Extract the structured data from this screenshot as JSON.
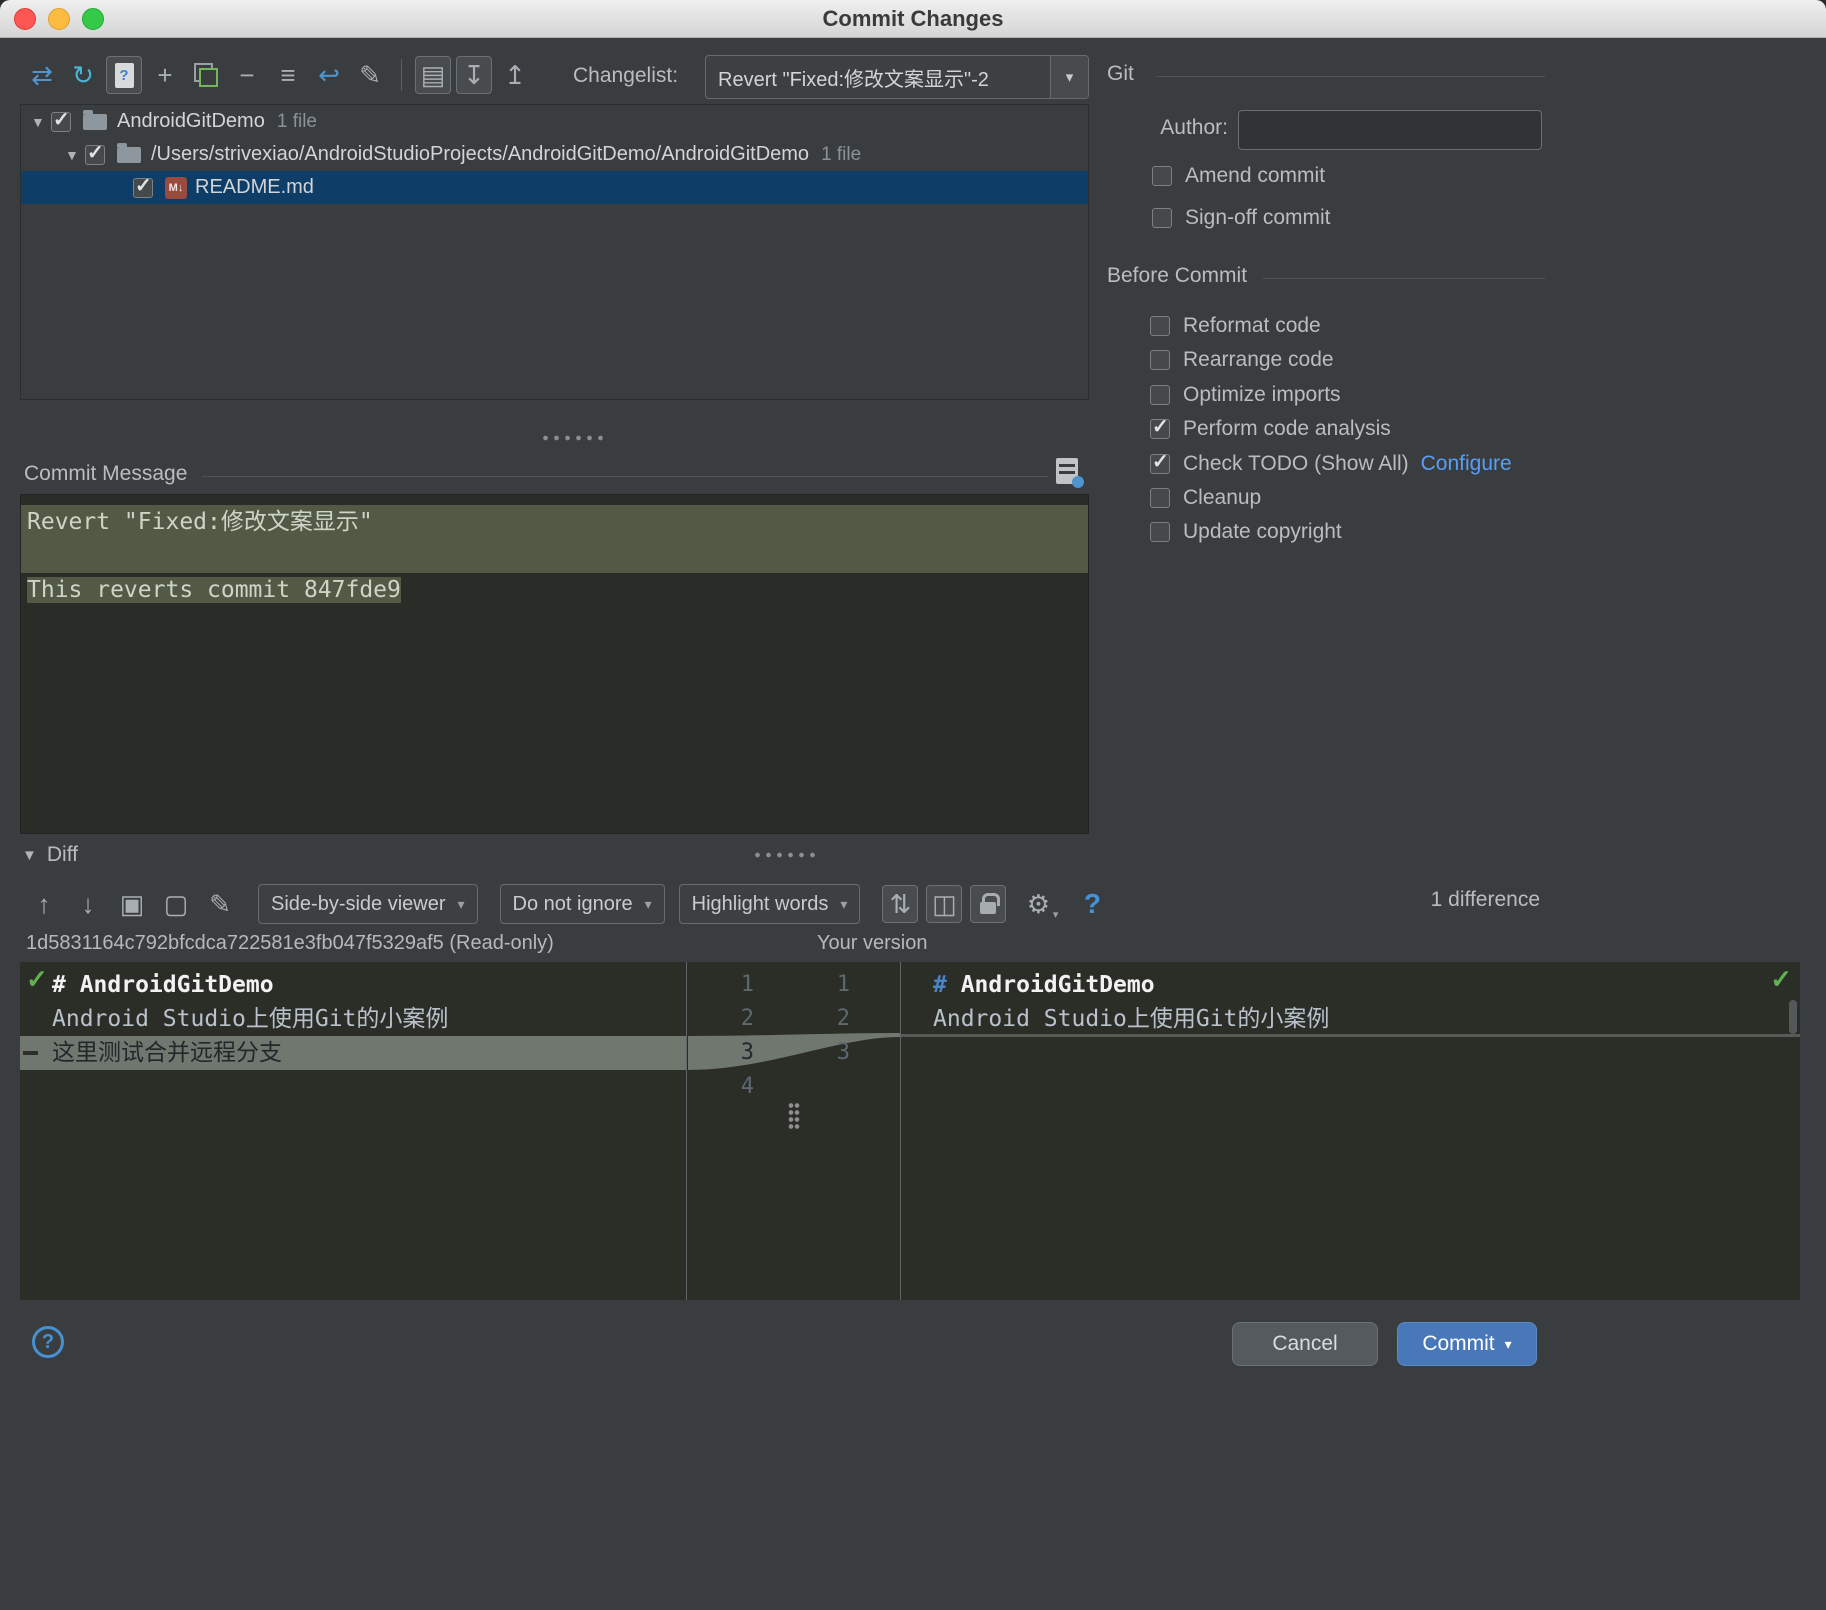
{
  "window": {
    "title": "Commit Changes"
  },
  "ui": {
    "arrow_down": "▾",
    "tree_expanded": "▼",
    "check": "✓"
  },
  "toolbar": {
    "changelist_label": "Changelist:",
    "changelist_value": "Revert \"Fixed:修改文案显示\"-2",
    "icon_glyphs": {
      "show_diff": "⇄",
      "refresh": "↻",
      "preview_doc": "?",
      "add": "+",
      "remove": "−",
      "group_by": "≡",
      "rollback": "↩",
      "edit": "✎",
      "details": "▤",
      "expand_all": "↧",
      "collapse_all": "↥"
    }
  },
  "tree": {
    "rows": [
      {
        "label": "AndroidGitDemo",
        "meta": "1 file",
        "checked": true
      },
      {
        "label": "/Users/strivexiao/AndroidStudioProjects/AndroidGitDemo/AndroidGitDemo",
        "meta": "1 file",
        "checked": true
      },
      {
        "label": "README.md",
        "meta": "",
        "checked": true,
        "selected": true
      }
    ],
    "file_badge": "M↓"
  },
  "commit": {
    "header": "Commit Message",
    "line1": "Revert \"Fixed:修改文案显示\"",
    "line2": " ",
    "line3": "This reverts commit 847fde9"
  },
  "git": {
    "title": "Git",
    "author_label": "Author:",
    "author_value": "",
    "amend": "Amend commit",
    "signoff": "Sign-off commit",
    "before_title": "Before Commit",
    "options": [
      {
        "label": "Reformat code",
        "checked": false
      },
      {
        "label": "Rearrange code",
        "checked": false
      },
      {
        "label": "Optimize imports",
        "checked": false
      },
      {
        "label": "Perform code analysis",
        "checked": true
      },
      {
        "label": "Check TODO (Show All)",
        "checked": true,
        "link": "Configure"
      },
      {
        "label": "Cleanup",
        "checked": false
      },
      {
        "label": "Update copyright",
        "checked": false
      }
    ]
  },
  "diff": {
    "header": "Diff",
    "icon_glyphs": {
      "prev": "↑",
      "next": "↓",
      "open_editor": "▣",
      "external": "▢",
      "edit": "✎",
      "sync_scroll": "⇅",
      "two_panes": "◫",
      "gear": "⚙",
      "help": "?"
    },
    "viewer_select": "Side-by-side viewer",
    "ignore_select": "Do not ignore",
    "highlight_select": "Highlight words",
    "count": "1 difference",
    "left_title": "1d5831164c792bfcdca722581e3fb047f5329af5 (Read-only)",
    "right_title": "Your version",
    "left": {
      "line1": "# AndroidGitDemo",
      "line2": "Android Studio上使用Git的小案例",
      "line3": "这里测试合并远程分支",
      "numbers": [
        "1",
        "2",
        "3",
        "4"
      ]
    },
    "right": {
      "hash": "#",
      "line1": " AndroidGitDemo",
      "line2": "Android Studio上使用Git的小案例",
      "numbers": [
        "1",
        "2",
        "3"
      ]
    }
  },
  "footer": {
    "help": "?",
    "cancel": "Cancel",
    "commit": "Commit"
  }
}
